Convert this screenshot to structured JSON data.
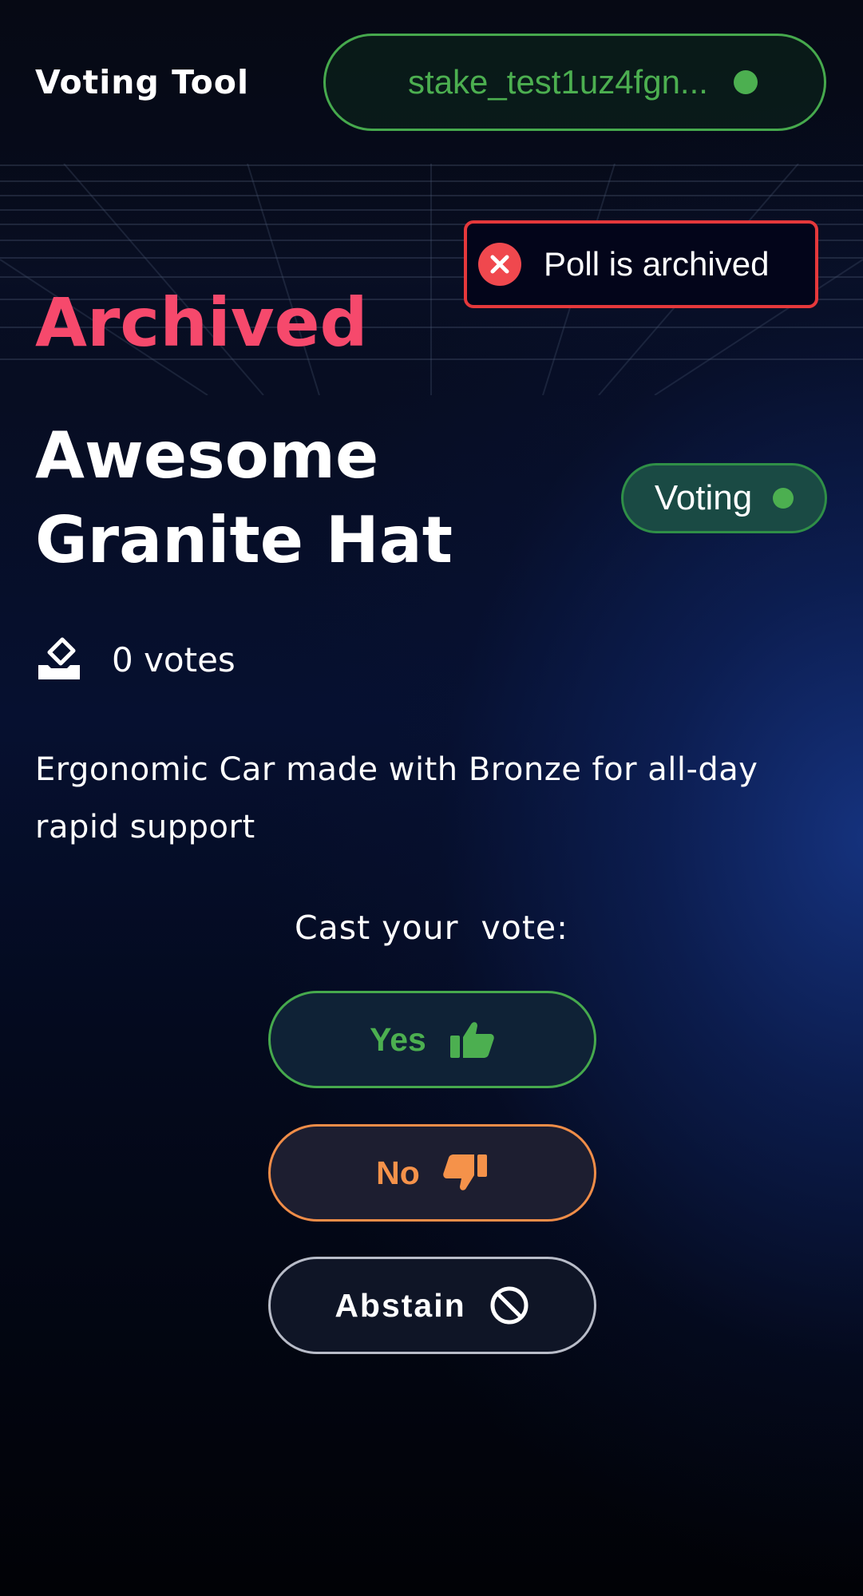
{
  "header": {
    "app_title": "Voting Tool",
    "wallet_address": "stake_test1uz4fgn...",
    "wallet_status_color": "#4caf50"
  },
  "toast": {
    "message": "Poll is archived",
    "icon": "close-circle-icon",
    "border_color": "#e5383b"
  },
  "poll": {
    "status_label": "Archived",
    "status_color": "#f6496c",
    "title": "Awesome Granite Hat",
    "phase_badge": "Voting",
    "vote_count_text": "0 votes",
    "description": "Ergonomic Car made with Bronze for all-day rapid support"
  },
  "vote": {
    "prompt": "Cast your  vote:",
    "options": [
      {
        "label": "Yes",
        "icon": "thumbs-up-icon",
        "color": "#4caf50"
      },
      {
        "label": "No",
        "icon": "thumbs-down-icon",
        "color": "#f5924a"
      },
      {
        "label": "Abstain",
        "icon": "ban-icon",
        "color": "#ffffff"
      }
    ]
  }
}
